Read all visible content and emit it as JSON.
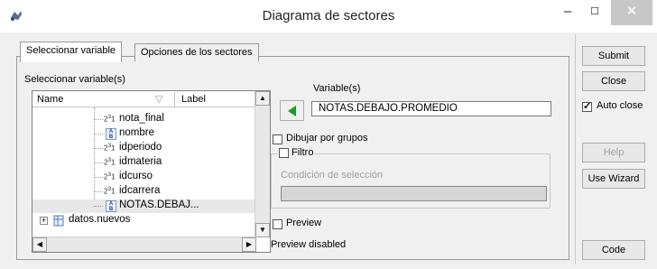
{
  "window": {
    "title": "Diagrama de sectores",
    "minimize": "–",
    "maximize": "☐",
    "close": "✕"
  },
  "tabs": [
    {
      "label": "Seleccionar variable",
      "active": true
    },
    {
      "label": "Opciones de los sectores",
      "active": false
    }
  ],
  "left": {
    "select_label": "Seleccionar variable(s)",
    "col_name": "Name",
    "col_label": "Label",
    "items": [
      {
        "name": "nota_final",
        "icon": "numeric-icon"
      },
      {
        "name": "nombre",
        "icon": "string-icon"
      },
      {
        "name": "idperiodo",
        "icon": "numeric-icon"
      },
      {
        "name": "idmateria",
        "icon": "numeric-icon"
      },
      {
        "name": "idcurso",
        "icon": "numeric-icon"
      },
      {
        "name": "idcarrera",
        "icon": "numeric-icon"
      },
      {
        "name": "NOTAS.DEBAJ...",
        "icon": "string-icon",
        "selected": true
      },
      {
        "name": "datos.nuevos",
        "icon": "dataset-icon"
      }
    ]
  },
  "right": {
    "variables_label": "Variable(s)",
    "variable_value": "NOTAS.DEBAJO.PROMEDIO",
    "group_label": "Dibujar por grupos",
    "filter_label": "Filtro",
    "condition_label": "Condición de selección",
    "preview_label": "Preview",
    "preview_status": "Preview disabled"
  },
  "buttons": {
    "submit": "Submit",
    "close": "Close",
    "auto_close": "Auto close",
    "help": "Help",
    "wizard": "Use Wizard",
    "code": "Code"
  },
  "colors": {
    "accent_arrow": "#1a9a2a",
    "title_text": "#222222"
  }
}
